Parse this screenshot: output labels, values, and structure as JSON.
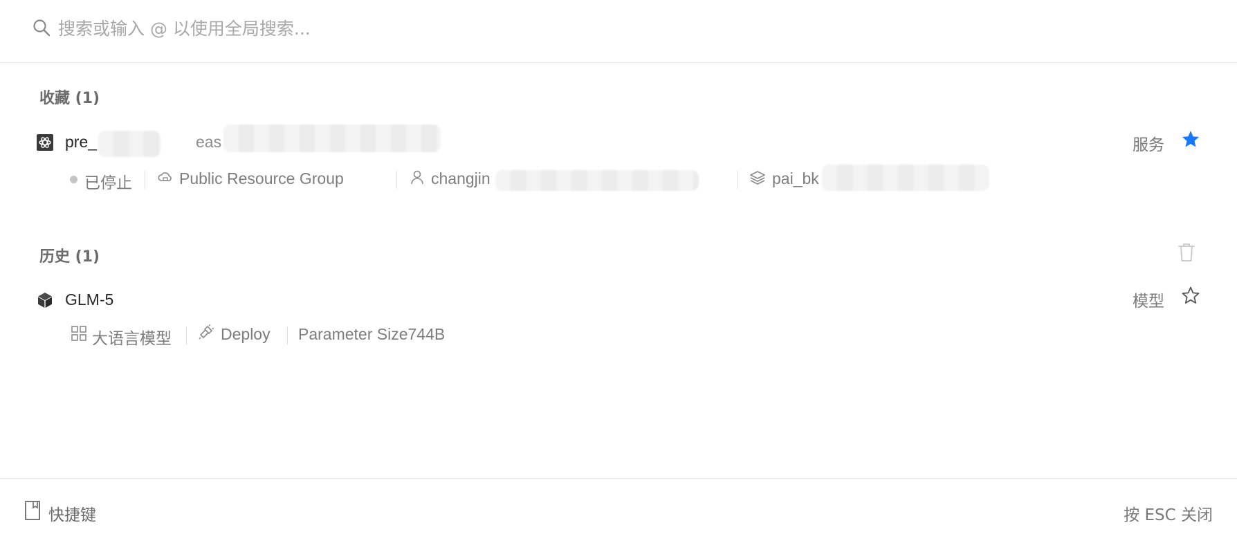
{
  "search": {
    "placeholder": "搜索或输入 @ 以使用全局搜索...",
    "icon": "search-icon"
  },
  "favorites": {
    "title": "收藏 (1)",
    "items": [
      {
        "name": "pre_",
        "subname": "eas",
        "type_label": "服务",
        "icon": "service-icon",
        "starred": true,
        "status": "已停止",
        "resource_group": "Public Resource Group",
        "owner": "changjin",
        "workspace": "pai_bk"
      }
    ]
  },
  "history": {
    "title": "历史 (1)",
    "items": [
      {
        "name": "GLM-5",
        "type_label": "模型",
        "icon": "model-cube-icon",
        "starred": false,
        "category": "大语言模型",
        "action": "Deploy",
        "param": "Parameter Size744B"
      }
    ]
  },
  "footer": {
    "shortcut_label": "快捷键",
    "esc_hint": "按 ESC 关闭"
  },
  "colors": {
    "star_active": "#1677ff",
    "text_muted": "#8c8c8c",
    "status_stopped": "#c4c4c4"
  }
}
